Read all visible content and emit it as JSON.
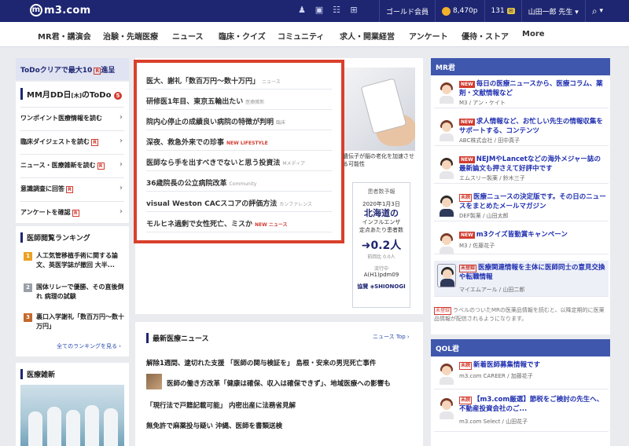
{
  "topbar": {
    "logo": "m3.com",
    "member_rank": "ゴールド会員",
    "points": "8,470p",
    "count": "131",
    "user": "山田一郎 先生 ▾",
    "search_icon": "search-icon"
  },
  "nav": [
    "MR君・講演会",
    "治験・先端医療",
    "ニュース",
    "臨床・クイズ",
    "コミュニティ",
    "求人・開業経営",
    "アンケート",
    "優待・ストア",
    "More"
  ],
  "left": {
    "banner": "ToDoクリアで最大10",
    "banner_tail": "進呈",
    "todo_title": "MM月DD日",
    "todo_day": "[木]",
    "todo_suffix": "のToDo",
    "todo_count": "5",
    "todo_items": [
      "ワンポイント医療情報を読む",
      "臨床ダイジェストを読む",
      "ニュース・医療雑新を読む",
      "意識調査に回答",
      "アンケートを確認"
    ],
    "ranking_title": "医師閲覧ランキング",
    "ranking": [
      {
        "num": "1",
        "text": "人工気管移植手術に関する論文、英医学誌が撤回 大半..."
      },
      {
        "num": "2",
        "text": "国体リレーで優勝、その直後倒れ 病理の試験"
      },
      {
        "num": "3",
        "text": "裏口入学謝礼「数百万円～数十万円」"
      }
    ],
    "ranking_more": "全てのランキングを見る ›",
    "zatsu_title": "医療雑新"
  },
  "feature": [
    {
      "text": "医大、謝礼「数百万円～数十万円」",
      "tag": "ニュース",
      "new": false
    },
    {
      "text": "研修医1年目、東京五輪出たい",
      "tag": "医療雑新",
      "new": false
    },
    {
      "text": "院内心停止の成績良い病院の特徴が判明",
      "tag": "臨床",
      "new": false
    },
    {
      "text": "深夜、救急外来での珍事",
      "tag": "NEW LIFESTYLE",
      "new": true
    },
    {
      "text": "医師なら手を出すべきでないと思う投資法",
      "tag": "Mメディア",
      "new": false
    },
    {
      "text": "36歳院長の公立病院改革",
      "tag": "Community",
      "new": false
    },
    {
      "text": "visual Weston CACスコアの評価方法",
      "tag": "カンファレンス",
      "new": false
    },
    {
      "text": "モルヒネ過剰で女性死亡、ミスか",
      "tag": "NEW ニュース",
      "new": true
    }
  ],
  "photo_caption": "遺伝子が脳の老化を加速させる可能性",
  "ad": {
    "head": "患者数予報",
    "date": "2020年1月3日",
    "region": "北海道の",
    "sub1": "インフルエンザ",
    "sub2": "定点あたり患者数",
    "value": "➜0.2人",
    "prev": "前回比 0.0人",
    "flow_label": "流行中",
    "flow_code": "A(H1)pdm09",
    "sponsor": "協賛 ◈SHIONOGI"
  },
  "news": {
    "title": "最新医療ニュース",
    "top_link": "ニュース Top ›",
    "items": [
      "解除1週間、逮切れた支援 「医師の関与検証を」 島根・安来の男児死亡事件",
      "医師の働き方改革「健康は確保、収入は確保できず」、地域医療への影響も",
      "「現行法で戸籍記載可能」 内密出産に法務省見解",
      "無免許で麻薬投与疑い 沖縄、医師を書類送検"
    ]
  },
  "mr": {
    "title": "MR君",
    "items": [
      {
        "tag": "NEW",
        "text": "毎日の医療ニュースから、医療コラム、薬剤・文献情報など",
        "sub": "M3 / アン・ケイト"
      },
      {
        "tag": "NEW",
        "text": "求人情報など、お忙しい先生の情報収集をサポートする、コンテンツ",
        "sub": "ABC株式会社 / 田中真子"
      },
      {
        "tag": "NEW",
        "text": "NEJMやLancetなどの海外メジャー誌の最新論文も押さえて好評中です",
        "sub": "エムスリー製薬 / 鈴木三子"
      },
      {
        "tag": "未読",
        "text": "医療ニュースの決定版です。その日のニュースをまとめたメールマガジン",
        "sub": "DEF製薬 / 山田太郎"
      },
      {
        "tag": "NEW",
        "text": "m3クイズ皆勤賞キャンペーン",
        "sub": "M3 / 佐藤花子"
      },
      {
        "tag": "未登録",
        "text": "医療関連情報を主体に医師同士の意見交換や転職情報",
        "sub": "マイエムアール / 山田二郎"
      }
    ],
    "note_tag": "未登録",
    "note": "ラベルのついたMRの医薬品情報を読むと、以降定期的に医薬品情報が配信されるようになります。"
  },
  "qol": {
    "title": "QOL君",
    "items": [
      {
        "tag": "未読",
        "text": "新着医師募集情報です",
        "sub": "m3.com CAREER / 加藤花子"
      },
      {
        "tag": "未読",
        "text": "【m3.com厳選】節税をご検討の先生へ、不動産投資会社のご...",
        "sub": "m3.com Select / 山田花子"
      }
    ]
  },
  "colors": {
    "brand": "#1e2672",
    "accent_red": "#d9402c",
    "link_blue": "#1e2eb0"
  }
}
